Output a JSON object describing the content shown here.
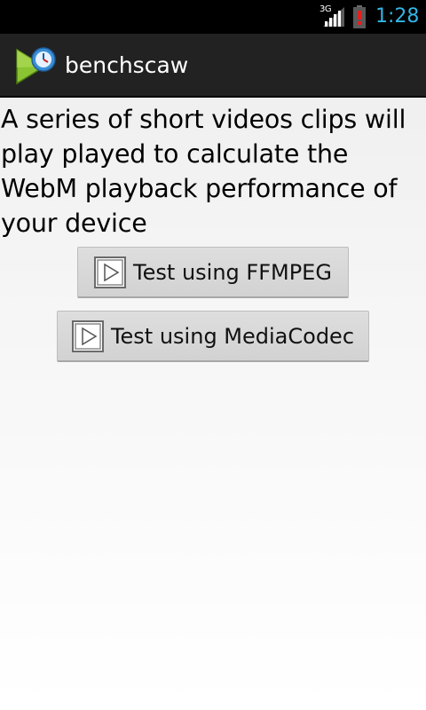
{
  "status_bar": {
    "network_type": "3G",
    "time": "1:28",
    "time_color": "#33b5e5",
    "icons": [
      "signal-icon",
      "battery-alert-icon"
    ]
  },
  "action_bar": {
    "title": "benchscaw",
    "icon": "app-play-icon"
  },
  "main": {
    "description": "A series of short videos clips will play played to calculate the WebM playback performance of your device",
    "buttons": [
      {
        "label": "Test using FFMPEG",
        "icon": "play-icon"
      },
      {
        "label": "Test using MediaCodec",
        "icon": "play-icon"
      }
    ]
  }
}
